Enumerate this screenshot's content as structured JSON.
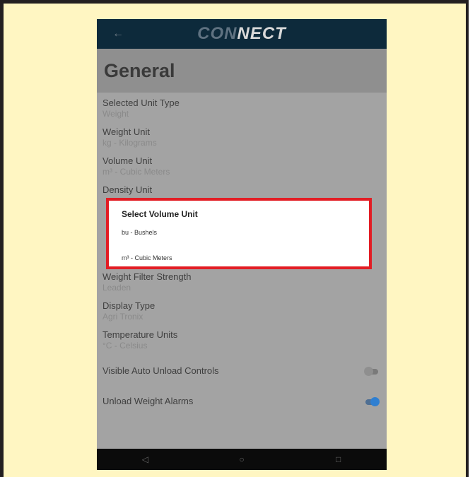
{
  "app": {
    "logo_dim": "CON",
    "logo_bright": "NECT",
    "back_glyph": "←"
  },
  "page": {
    "title": "General"
  },
  "settings": [
    {
      "label": "Selected Unit Type",
      "value": "Weight"
    },
    {
      "label": "Weight Unit",
      "value": "kg - Kilograms"
    },
    {
      "label": "Volume Unit",
      "value": "m³ - Cubic Meters"
    },
    {
      "label": "Density Unit",
      "value": ""
    },
    {
      "label": "Weight Filter Strength",
      "value": "Leaden"
    },
    {
      "label": "Display Type",
      "value": "Agri Tronix"
    },
    {
      "label": "Temperature Units",
      "value": "°C - Celsius"
    }
  ],
  "toggles": [
    {
      "label": "Visible Auto Unload Controls",
      "on": false
    },
    {
      "label": "Unload Weight Alarms",
      "on": true
    }
  ],
  "dialog": {
    "title": "Select Volume Unit",
    "options": [
      "bu - Bushels",
      "m³ - Cubic Meters"
    ]
  },
  "navbar": {
    "back": "◁",
    "home": "○",
    "recents": "□"
  },
  "colors": {
    "highlight_border": "#e21d24",
    "appbar": "#0d2a3b",
    "frame": "#fff6c2",
    "toggle_on": "#2f7fd1"
  }
}
